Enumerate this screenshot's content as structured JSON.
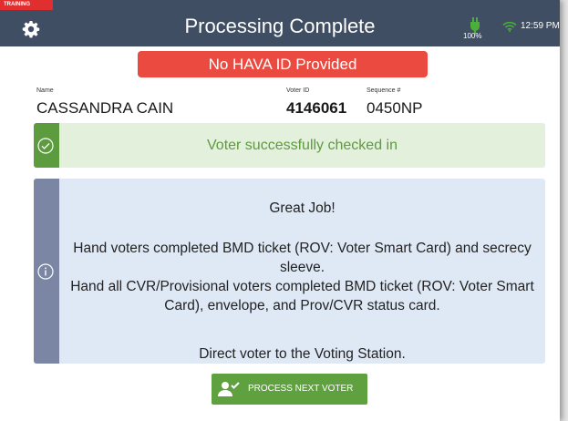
{
  "header": {
    "training_label": "TRAINING",
    "title": "Processing Complete",
    "battery": "100%",
    "time": "12:59 PM"
  },
  "alert": {
    "text": "No HAVA ID Provided"
  },
  "voter": {
    "name_label": "Name",
    "name": "CASSANDRA CAIN",
    "id_label": "Voter ID",
    "id": "4146061",
    "seq_label": "Sequence #",
    "seq": "0450NP"
  },
  "success": {
    "text": "Voter successfully checked in"
  },
  "info": {
    "line1": "Great Job!",
    "paragraph": "Hand voters completed BMD ticket (ROV: Voter Smart Card) and secrecy sleeve.\nHand all CVR/Provisional voters completed BMD ticket (ROV: Voter Smart Card), envelope, and Prov/CVR status card.",
    "line5": "Direct voter to the Voting Station."
  },
  "action": {
    "label": "PROCESS NEXT VOTER"
  },
  "icons": {
    "settings": "gear-icon",
    "power": "plug-icon",
    "wifi": "wifi-icon",
    "success": "check-circle-icon",
    "info": "info-circle-icon",
    "next": "user-check-icon"
  },
  "colors": {
    "header_bg": "#3f4e62",
    "alert_bg": "#ea4a3f",
    "success_bar": "#5d9b3f",
    "success_bg": "#e3f0dc",
    "info_bar": "#7a86a3",
    "info_bg": "#dfe9f6",
    "button_bg": "#5fa13e",
    "training_bg": "#e12e2e"
  }
}
